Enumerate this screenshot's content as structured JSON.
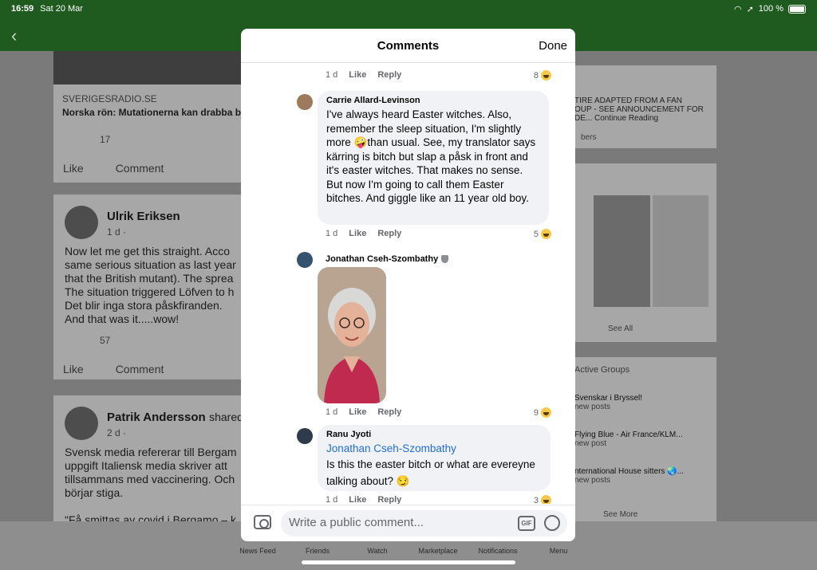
{
  "status_bar": {
    "time": "16:59",
    "date": "Sat 20 Mar",
    "battery": "100 %"
  },
  "background_feed": {
    "post1": {
      "source": "SVERIGESRADIO.SE",
      "headline": "Norska rön: Mutationerna kan drabba b",
      "reaction_count": "17",
      "like": "Like",
      "comment": "Comment"
    },
    "post2": {
      "author": "Ulrik Eriksen",
      "time": "1 d ·",
      "lines": [
        "Now let me get this straight. Acco",
        "same serious situation as last year",
        "that the British mutant). The sprea",
        "The situation triggered Löfven to h",
        "Det blir inga stora påskfiranden.",
        "And that was it.....wow!"
      ],
      "reaction_count": "57",
      "like": "Like",
      "comment": "Comment"
    },
    "post3": {
      "author": "Patrik Andersson",
      "shared": "shared",
      "time": "2 d ·",
      "lines": [
        "Svensk media refererar till Bergam",
        "uppgift Italiensk media skriver att",
        "tillsammans med vaccinering. Och",
        "börjar stiga.",
        "",
        "\"Få smittas av covid i Bergamo – k"
      ]
    },
    "right_card1": {
      "lines": [
        "TIRE ADAPTED FROM A FAN",
        "OUP - SEE ANNOUNCEMENT FOR",
        "DE..."
      ],
      "continue": "Continue Reading",
      "members": "bers"
    },
    "right_card2": {
      "see_all": "See All"
    },
    "groups": {
      "title": "Active Groups",
      "items": [
        {
          "name": "Svenskar i Bryssel!",
          "posts": "new posts"
        },
        {
          "name": "Flying Blue - Air France/KLM...",
          "posts": "new post"
        },
        {
          "name": "nternational House sitters 🌏...",
          "posts": "new posts"
        }
      ],
      "see_more": "See More"
    }
  },
  "tabbar": {
    "items": [
      "News Feed",
      "Friends",
      "Watch",
      "Marketplace",
      "Notifications",
      "Menu"
    ]
  },
  "modal": {
    "title": "Comments",
    "done": "Done",
    "comments": [
      {
        "time": "1 d",
        "like": "Like",
        "reply": "Reply",
        "reactions": "8"
      },
      {
        "author": "Carrie Allard-Levinson",
        "text": "I've always heard Easter witches.  Also, remember the sleep situation, I'm slightly more 🤪than usual.  See, my translator says kärring is bitch but slap a påsk in front and it's easter witches.  That makes no sense.  But now I'm going to call them Easter bitches.  And giggle like an 11 year old boy.",
        "time": "1 d",
        "like": "Like",
        "reply": "Reply",
        "reactions": "5"
      },
      {
        "author": "Jonathan Cseh-Szombathy",
        "time": "1 d",
        "like": "Like",
        "reply": "Reply",
        "reactions": "9"
      },
      {
        "author": "Ranu Jyoti",
        "mention": "Jonathan Cseh-Szombathy",
        "text": "Is this the easter bitch or what are evereyne talking about? 😏",
        "time": "1 d",
        "like": "Like",
        "reply": "Reply",
        "reactions": "3"
      }
    ],
    "composer": {
      "placeholder": "Write a public comment...",
      "gif": "GIF"
    }
  }
}
